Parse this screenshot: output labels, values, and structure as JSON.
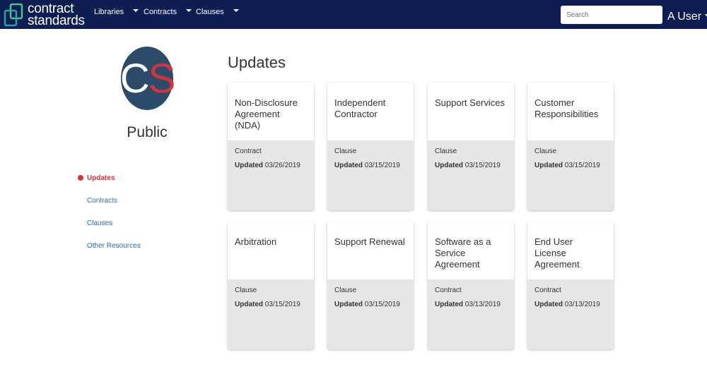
{
  "navbar": {
    "brand_line1": "contract",
    "brand_line2": "standards",
    "menu": [
      {
        "label": "Libraries"
      },
      {
        "label": "Contracts"
      },
      {
        "label": "Clauses"
      }
    ],
    "search_placeholder": "Search",
    "user_label": "A User"
  },
  "sidebar": {
    "avatar_letter1": "C",
    "avatar_letter2": "S",
    "library_name": "Public",
    "items": [
      {
        "label": "Updates",
        "active": true
      },
      {
        "label": "Contracts"
      },
      {
        "label": "Clauses"
      },
      {
        "label": "Other Resources"
      }
    ]
  },
  "main": {
    "title": "Updates",
    "updated_label": "Updated",
    "cards": [
      {
        "title": "Non-Disclosure Agreement (NDA)",
        "type": "Contract",
        "date": "03/26/2019"
      },
      {
        "title": "Independent Contractor",
        "type": "Clause",
        "date": "03/15/2019"
      },
      {
        "title": "Support Services",
        "type": "Clause",
        "date": "03/15/2019"
      },
      {
        "title": "Customer Responsibilities",
        "type": "Clause",
        "date": "03/15/2019"
      },
      {
        "title": "Arbitration",
        "type": "Clause",
        "date": "03/15/2019"
      },
      {
        "title": "Support Renewal",
        "type": "Clause",
        "date": "03/15/2019"
      },
      {
        "title": "Software as a Service Agreement",
        "type": "Contract",
        "date": "03/13/2019"
      },
      {
        "title": "End User License Agreement",
        "type": "Contract",
        "date": "03/13/2019"
      }
    ]
  },
  "colors": {
    "navbar": "#0e1d52",
    "accent_red": "#d9322f",
    "link_blue": "#2a6fb5",
    "avatar_bg": "#2c4b6a"
  }
}
